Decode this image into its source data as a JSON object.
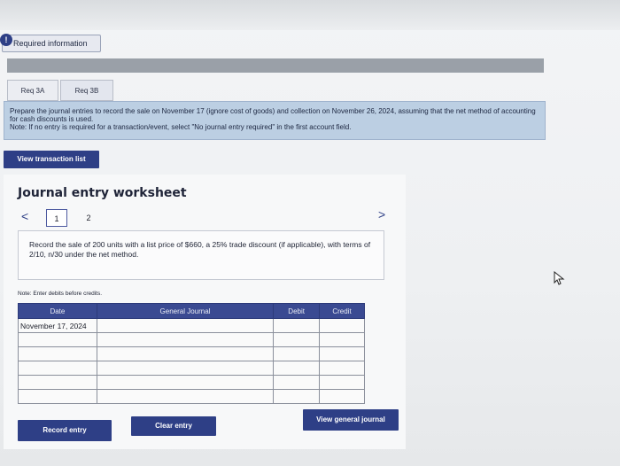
{
  "header": {
    "info_badge": "!",
    "required_information": "Required information"
  },
  "tabs": [
    {
      "label": "Req 3A"
    },
    {
      "label": "Req 3B"
    }
  ],
  "instructions": {
    "text": "Prepare the journal entries to record the sale on November 17 (ignore cost of goods) and collection on November 26, 2024, assuming that the net method of accounting for cash discounts is used.",
    "note": "Note: If no entry is required for a transaction/event, select \"No journal entry required\" in the first account field."
  },
  "view_transaction_list": "View transaction list",
  "worksheet": {
    "title": "Journal entry worksheet",
    "prev": "<",
    "next": ">",
    "pages": [
      "1",
      "2"
    ],
    "record_text": "Record the sale of 200 units with a list price of $660, a 25% trade discount (if applicable), with terms of 2/10, n/30 under the net method.",
    "note": "Note: Enter debits before credits.",
    "table": {
      "headers": {
        "date": "Date",
        "account": "General Journal",
        "debit": "Debit",
        "credit": "Credit"
      },
      "rows": [
        {
          "date": "November 17, 2024"
        },
        {
          "date": ""
        },
        {
          "date": ""
        },
        {
          "date": ""
        },
        {
          "date": ""
        },
        {
          "date": ""
        }
      ]
    },
    "buttons": {
      "record": "Record entry",
      "clear": "Clear entry",
      "view_general_journal": "View general journal"
    }
  },
  "colors": {
    "primary": "#2e3f86",
    "instruction_bg": "#bccfe3"
  }
}
